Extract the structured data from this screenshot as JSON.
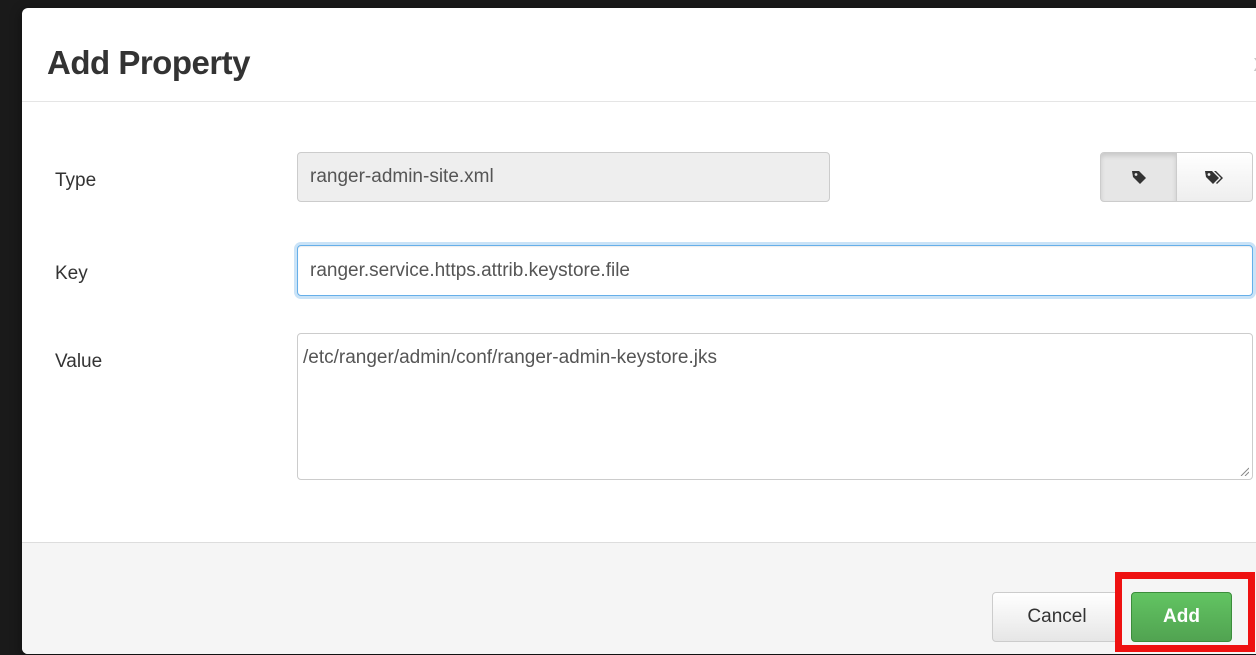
{
  "dialog": {
    "title": "Add Property",
    "close_label": "x"
  },
  "form": {
    "type": {
      "label": "Type",
      "value": "ranger-admin-site.xml"
    },
    "key": {
      "label": "Key",
      "value": "ranger.service.https.attrib.keystore.file"
    },
    "value": {
      "label": "Value",
      "value": "/etc/ranger/admin/conf/ranger-admin-keystore.jks"
    }
  },
  "tag_toggle": {
    "options": [
      {
        "icon": "tag-icon",
        "selected": true
      },
      {
        "icon": "tags-icon",
        "selected": false
      }
    ]
  },
  "footer": {
    "cancel_label": "Cancel",
    "add_label": "Add"
  },
  "annotation": {
    "highlight_color": "#ee1111",
    "highlights": "add-button"
  },
  "colors": {
    "primary_green": "#5bb75b",
    "focus_blue": "#66afe9"
  }
}
